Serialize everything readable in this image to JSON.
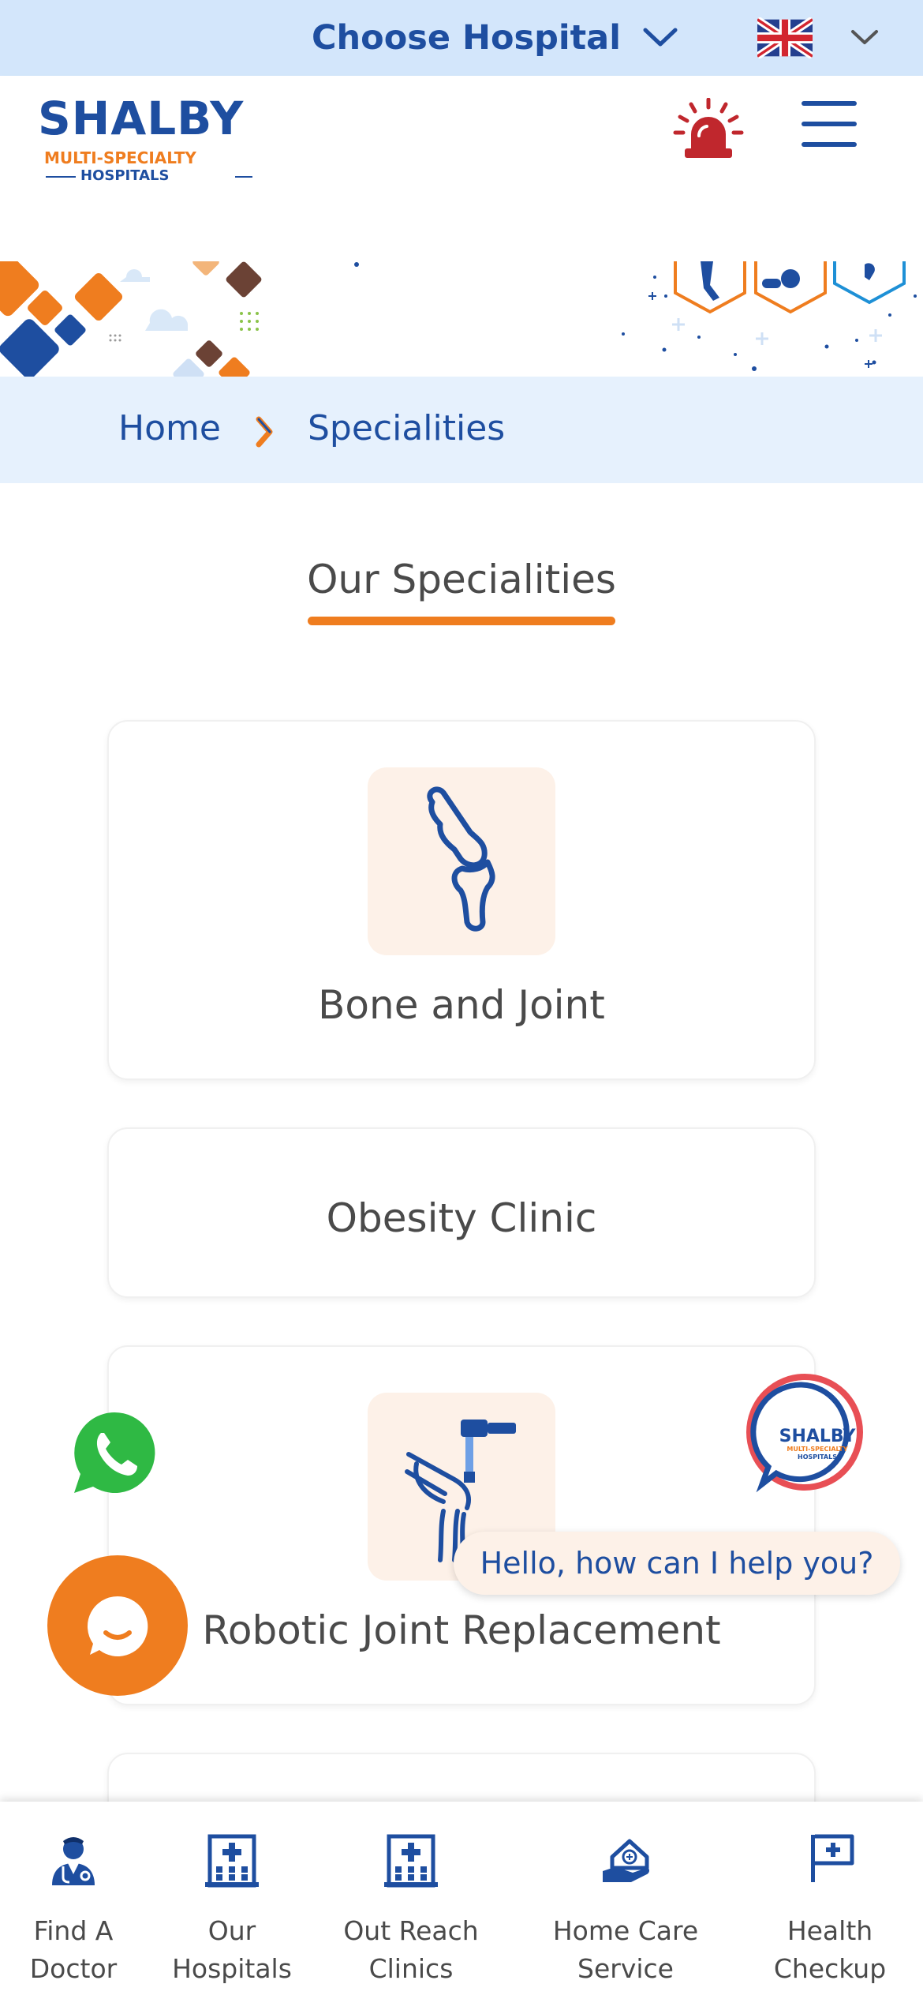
{
  "topbar": {
    "choose_hospital_label": "Choose Hospital",
    "language_flag": "uk-flag-icon"
  },
  "header": {
    "logo": {
      "brand": "SHALBY",
      "line1": "MULTI-SPECIALTY",
      "line2": "HOSPITALS"
    },
    "emergency_icon": "siren-icon",
    "menu_icon": "hamburger-menu-icon"
  },
  "breadcrumb": {
    "home": "Home",
    "current": "Specialities"
  },
  "section": {
    "title": "Our Specialities"
  },
  "specialities": [
    {
      "label": "Bone and Joint",
      "icon": "bone-joint-icon"
    },
    {
      "label": "Obesity Clinic",
      "icon": ""
    },
    {
      "label": "Robotic Joint Replacement",
      "icon": "robotic-knee-icon"
    }
  ],
  "chat": {
    "greeting": "Hello, how can I help you?",
    "bot_badge": {
      "brand": "SHALBY",
      "line1": "MULTI-SPECIALTY",
      "line2": "HOSPITALS"
    }
  },
  "bottom_nav": [
    {
      "label": "Find A\nDoctor",
      "icon": "doctor-icon"
    },
    {
      "label": "Our\nHospitals",
      "icon": "hospital-building-icon"
    },
    {
      "label": "Out Reach\nClinics",
      "icon": "clinic-building-icon"
    },
    {
      "label": "Home Care\nService",
      "icon": "home-care-icon"
    },
    {
      "label": "Health\nCheckup",
      "icon": "health-flag-icon"
    }
  ],
  "colors": {
    "primary_blue": "#1e4ea0",
    "accent_orange": "#ef7d1f",
    "topbar_bg": "#d3e6fb",
    "breadcrumb_bg": "#e6f1fd",
    "whatsapp_green": "#2fb944",
    "siren_red": "#c0272d"
  }
}
